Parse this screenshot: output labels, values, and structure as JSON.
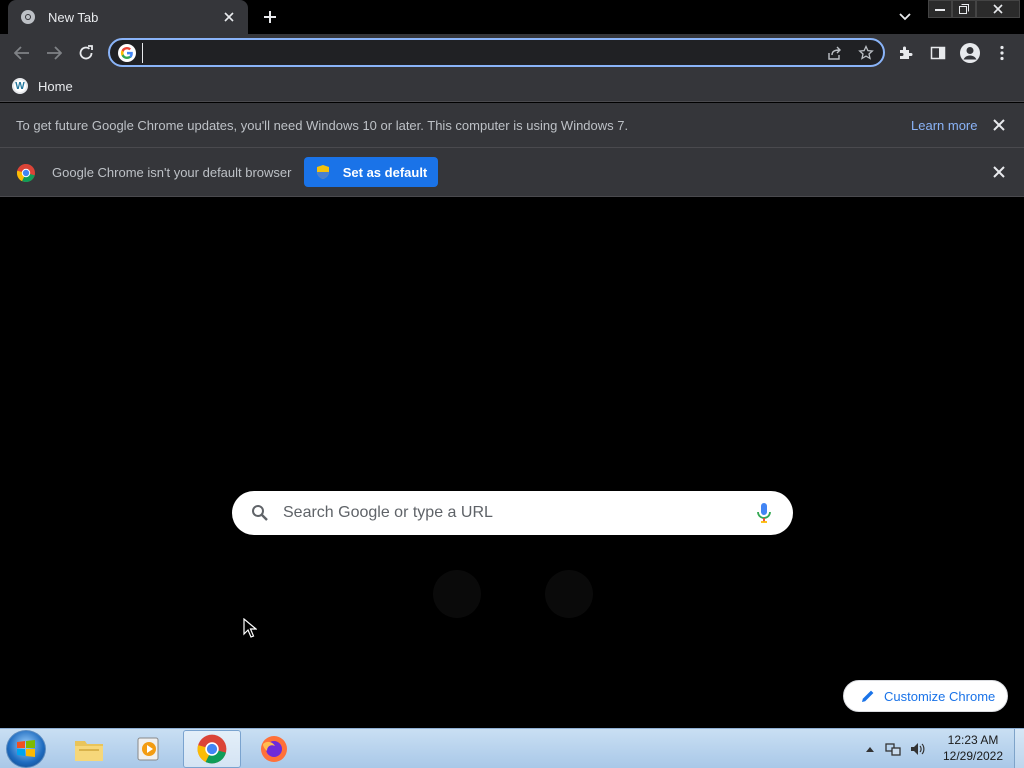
{
  "tab": {
    "title": "New Tab",
    "close_icon": "close-icon"
  },
  "toolbar": {
    "address_value": "",
    "address_placeholder": ""
  },
  "bookmarks": {
    "items": [
      {
        "label": "Home",
        "icon": "wordpress-icon"
      }
    ]
  },
  "infobar_update": {
    "message": "To get future Google Chrome updates, you'll need Windows 10 or later. This computer is using Windows 7.",
    "link": "Learn more"
  },
  "infobar_default": {
    "message": "Google Chrome isn't your default browser",
    "button": "Set as default"
  },
  "ntp": {
    "search_placeholder": "Search Google or type a URL",
    "customize_label": "Customize Chrome"
  },
  "taskbar": {
    "apps": [
      "windows-explorer",
      "media-player",
      "google-chrome",
      "firefox"
    ],
    "active_app": "google-chrome",
    "time": "12:23 AM",
    "date": "12/29/2022"
  },
  "colors": {
    "accent": "#8ab4f8",
    "button_blue": "#1a73e8",
    "toolbar_bg": "#35363a"
  }
}
